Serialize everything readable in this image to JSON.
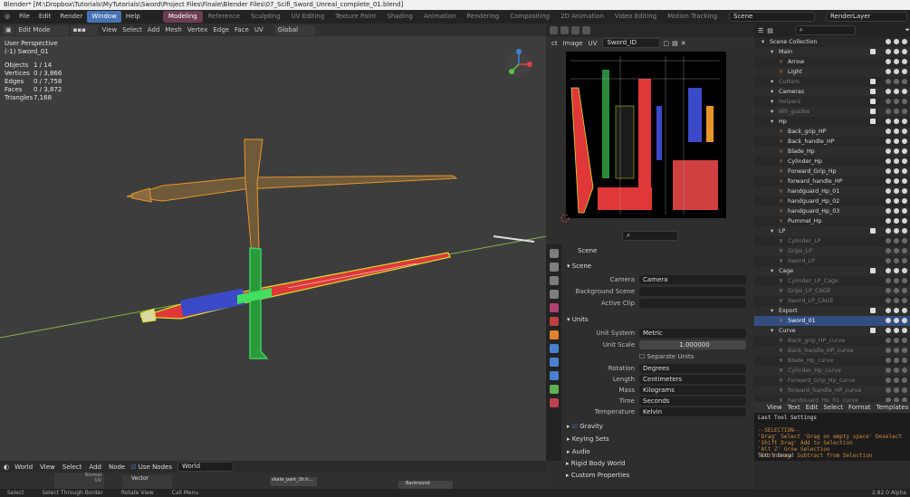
{
  "window_title": "Blender* [M:\\Dropbox\\Tutorials\\MyTutorials\\Sword\\Project Files\\Finale\\Blender Files\\07_Scifi_Sword_Unreal_complete_01.blend]",
  "menus": [
    "File",
    "Edit",
    "Render",
    "Window",
    "Help"
  ],
  "workspaces": [
    "Modeling",
    "Reference",
    "Sculpting",
    "UV Editing",
    "Texture Paint",
    "Shading",
    "Animation",
    "Rendering",
    "Compositing",
    "2D Animation",
    "Video Editing",
    "Motion Tracking",
    "Scripting"
  ],
  "scene_field": "Scene",
  "render_layer_field": "RenderLayer",
  "viewport": {
    "mode": "Edit Mode",
    "menu": [
      "View",
      "Select",
      "Add",
      "Mesh",
      "Vertex",
      "Edge",
      "Face",
      "UV"
    ],
    "orientation": "Global",
    "view_name": "User Perspective",
    "object_name": "(-1) Sword_01",
    "stats": [
      {
        "label": "Objects",
        "value": "1 / 14"
      },
      {
        "label": "Vertices",
        "value": "0 / 3,866"
      },
      {
        "label": "Edges",
        "value": "0 / 7,758"
      },
      {
        "label": "Faces",
        "value": "0 / 3,872"
      },
      {
        "label": "Triangles",
        "value": "7,168"
      }
    ]
  },
  "uv_editor": {
    "menu": [
      "ct",
      "Image",
      "UV"
    ],
    "image_name": "Sword_ID"
  },
  "properties": {
    "breadcrumb": "Scene",
    "section_scene": "Scene",
    "camera_label": "Camera",
    "camera_value": "Camera",
    "background_label": "Background Scene",
    "clip_label": "Active Clip",
    "section_units": "Units",
    "unit_system_label": "Unit System",
    "unit_system": "Metric",
    "unit_scale_label": "Unit Scale",
    "unit_scale": "1.000000",
    "separate_units": "Separate Units",
    "rotation_label": "Rotation",
    "rotation": "Degrees",
    "length_label": "Length",
    "length": "Centimeters",
    "mass_label": "Mass",
    "mass": "Kilograms",
    "time_label": "Time",
    "time": "Seconds",
    "temperature_label": "Temperature",
    "temperature": "Kelvin",
    "gravity": "Gravity",
    "keying_sets": "Keying Sets",
    "audio": "Audio",
    "rigid_body": "Rigid Body World",
    "custom_props": "Custom Properties"
  },
  "outliner": {
    "rows": [
      {
        "label": "Scene Collection",
        "indent": 0,
        "dim": false
      },
      {
        "label": "Main",
        "indent": 1,
        "dim": false
      },
      {
        "label": "Arrow",
        "indent": 2,
        "dim": false,
        "color": "#f0a050"
      },
      {
        "label": "Light",
        "indent": 2,
        "dim": false,
        "color": "#f0a050"
      },
      {
        "label": "Cutters",
        "indent": 1,
        "dim": true
      },
      {
        "label": "Cameras",
        "indent": 1,
        "dim": false
      },
      {
        "label": "Helpers",
        "indent": 1,
        "dim": true
      },
      {
        "label": "Wh_guides",
        "indent": 1,
        "dim": true
      },
      {
        "label": "Hp",
        "indent": 1,
        "dim": false
      },
      {
        "label": "Back_grip_HP",
        "indent": 2,
        "dim": false,
        "color": "#f0a050"
      },
      {
        "label": "Back_handle_HP",
        "indent": 2,
        "dim": false,
        "color": "#f0a050"
      },
      {
        "label": "Blade_Hp",
        "indent": 2,
        "dim": false,
        "color": "#f0a050"
      },
      {
        "label": "Cylinder_Hp",
        "indent": 2,
        "dim": false,
        "color": "#f0a050"
      },
      {
        "label": "Forward_Grip_Hp",
        "indent": 2,
        "dim": false,
        "color": "#f0a050"
      },
      {
        "label": "forward_handle_HP",
        "indent": 2,
        "dim": false,
        "color": "#f0a050"
      },
      {
        "label": "handguard_Hp_01",
        "indent": 2,
        "dim": false,
        "color": "#f0a050"
      },
      {
        "label": "handguard_Hp_02",
        "indent": 2,
        "dim": false,
        "color": "#f0a050"
      },
      {
        "label": "handguard_Hp_03",
        "indent": 2,
        "dim": false,
        "color": "#f0a050"
      },
      {
        "label": "Pummel_Hp",
        "indent": 2,
        "dim": false,
        "color": "#f0a050"
      },
      {
        "label": "LP",
        "indent": 1,
        "dim": false
      },
      {
        "label": "Cylinder_LP",
        "indent": 2,
        "dim": true
      },
      {
        "label": "Grips_LP",
        "indent": 2,
        "dim": true
      },
      {
        "label": "Sword_LP",
        "indent": 2,
        "dim": true
      },
      {
        "label": "Cage",
        "indent": 1,
        "dim": false
      },
      {
        "label": "Cylinder_LP_Cage",
        "indent": 2,
        "dim": true
      },
      {
        "label": "Grips_LP_CAGE",
        "indent": 2,
        "dim": true
      },
      {
        "label": "Sword_LP_CAGE",
        "indent": 2,
        "dim": true
      },
      {
        "label": "Export",
        "indent": 1,
        "dim": false
      },
      {
        "label": "Sword_01",
        "indent": 2,
        "dim": false,
        "selected": true,
        "color": "#f0a050"
      },
      {
        "label": "Curve",
        "indent": 1,
        "dim": false
      },
      {
        "label": "Back_grip_HP_curve",
        "indent": 2,
        "dim": true
      },
      {
        "label": "Back_handle_HP_curve",
        "indent": 2,
        "dim": true
      },
      {
        "label": "Blade_Hp_curve",
        "indent": 2,
        "dim": true
      },
      {
        "label": "Cylinder_Hp_curve",
        "indent": 2,
        "dim": true
      },
      {
        "label": "Forward_Grip_Hp_curve",
        "indent": 2,
        "dim": true
      },
      {
        "label": "forward_handle_HP_curve",
        "indent": 2,
        "dim": true
      },
      {
        "label": "handguard_Hp_01_curve",
        "indent": 2,
        "dim": true
      }
    ]
  },
  "text_editor": {
    "menu": [
      "View",
      "Text",
      "Edit",
      "Select",
      "Format",
      "Templates"
    ],
    "lines": [
      "Last Tool Settings",
      "",
      "--SELECTION--",
      "'Drag' Select 'Drag on empty space' Deselect",
      "'Shift Drag' Add to Selection",
      "'Alt Z' Grow Selection",
      "'Ctrl Drag' Subtract from Selection"
    ],
    "footer": "Text: Internal"
  },
  "node_editor": {
    "menu": [
      "World",
      "View",
      "Select",
      "Add",
      "Node"
    ],
    "use_nodes": "Use Nodes",
    "world_field": "World",
    "node_labels": [
      "Normal",
      "UV",
      "Vector"
    ],
    "image_node": "skate_park_2k.h...",
    "background_node": "Backround"
  },
  "status": {
    "items": [
      "Select",
      "Select Through Border",
      "Rotate View",
      "Call Menu"
    ],
    "version": "2.82.0 Alpha"
  }
}
